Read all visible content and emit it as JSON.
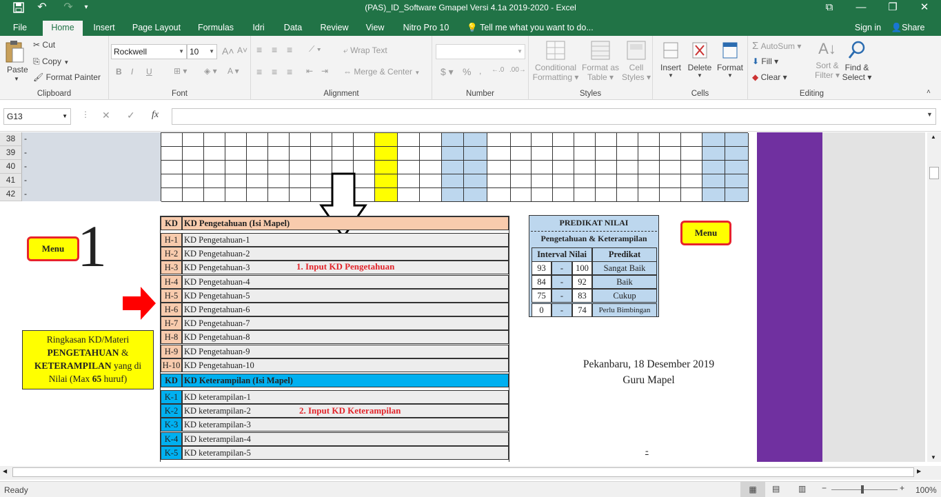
{
  "window": {
    "title": "(PAS)_ID_Software Gmapel Versi 4.1a 2019-2020  -  Excel",
    "quick_access": {
      "save": "save-icon",
      "undo": "undo-icon",
      "redo": "redo-icon",
      "customize": "▾"
    }
  },
  "tabs": [
    "File",
    "Home",
    "Insert",
    "Page Layout",
    "Formulas",
    "Idri",
    "Data",
    "Review",
    "View",
    "Nitro Pro 10"
  ],
  "tell_me": "Tell me what you want to do...",
  "account": {
    "signin": "Sign in",
    "share": "Share"
  },
  "ribbon": {
    "clipboard": {
      "paste": "Paste",
      "cut": "Cut",
      "copy": "Copy",
      "format_painter": "Format Painter",
      "label": "Clipboard"
    },
    "font": {
      "name": "Rockwell",
      "size": "10",
      "label": "Font",
      "bold": "B",
      "italic": "I",
      "underline": "U"
    },
    "alignment": {
      "wrap": "Wrap Text",
      "merge": "Merge & Center",
      "label": "Alignment"
    },
    "number": {
      "format": "",
      "label": "Number",
      "currency": "$",
      "percent": "%"
    },
    "styles": {
      "conditional": "Conditional",
      "conditional2": "Formatting",
      "format_table": "Format as",
      "format_table2": "Table",
      "cell_styles": "Cell",
      "cell_styles2": "Styles",
      "label": "Styles"
    },
    "cells": {
      "insert": "Insert",
      "delete": "Delete",
      "format": "Format",
      "label": "Cells"
    },
    "editing": {
      "autosum": "AutoSum",
      "fill": "Fill",
      "clear": "Clear",
      "sort": "Sort &",
      "sort2": "Filter",
      "find": "Find &",
      "find2": "Select",
      "label": "Editing"
    }
  },
  "formula_bar": {
    "name_box": "G13",
    "fx": "fx",
    "content": ""
  },
  "rows": [
    {
      "num": "38",
      "val": "-"
    },
    {
      "num": "39",
      "val": "-"
    },
    {
      "num": "40",
      "val": "-"
    },
    {
      "num": "41",
      "val": "-"
    },
    {
      "num": "42",
      "val": "-"
    }
  ],
  "sheet": {
    "menu_left": "Menu",
    "menu_right": "Menu",
    "big_number": "1",
    "summary_note": {
      "l1": "Ringkasan KD/Materi",
      "l2": "PENGETAHUAN",
      "l2b": " &",
      "l3": "KETERAMPILAN",
      "l3b": " yang di",
      "l4a": "Nilai (Max ",
      "l4b": "65",
      "l4c": " huruf)"
    },
    "kd_header_p": {
      "code": "KD",
      "title": "KD Pengetahuan (Isi Mapel)"
    },
    "kd_p": [
      {
        "code": "H-1",
        "name": "KD Pengetahuan-1"
      },
      {
        "code": "H-2",
        "name": "KD Pengetahuan-2"
      },
      {
        "code": "H-3",
        "name": "KD Pengetahuan-3"
      },
      {
        "code": "H-4",
        "name": "KD Pengetahuan-4"
      },
      {
        "code": "H-5",
        "name": "KD Pengetahuan-5"
      },
      {
        "code": "H-6",
        "name": "KD Pengetahuan-6"
      },
      {
        "code": "H-7",
        "name": "KD Pengetahuan-7"
      },
      {
        "code": "H-8",
        "name": "KD Pengetahuan-8"
      },
      {
        "code": "H-9",
        "name": "KD Pengetahuan-9"
      },
      {
        "code": "H-10",
        "name": "KD Pengetahuan-10"
      }
    ],
    "kd_header_k": {
      "code": "KD",
      "title": "KD Keterampilan (Isi Mapel)"
    },
    "kd_k": [
      {
        "code": "K-1",
        "name": "KD keterampilan-1"
      },
      {
        "code": "K-2",
        "name": "KD keterampilan-2"
      },
      {
        "code": "K-3",
        "name": "KD keterampilan-3"
      },
      {
        "code": "K-4",
        "name": "KD keterampilan-4"
      },
      {
        "code": "K-5",
        "name": "KD keterampilan-5"
      }
    ],
    "note_p": "1. Input KD Pengetahuan",
    "note_k": "2. Input KD Keterampilan",
    "predikat": {
      "title": "PREDIKAT NILAI",
      "subtitle": "Pengetahuan & Keterampilan",
      "col1": "Interval Nilai",
      "col2": "Predikat",
      "rows": [
        {
          "lo": "93",
          "dash": "-",
          "hi": "100",
          "label": "Sangat Baik"
        },
        {
          "lo": "84",
          "dash": "-",
          "hi": "92",
          "label": "Baik"
        },
        {
          "lo": "75",
          "dash": "-",
          "hi": "83",
          "label": "Cukup"
        },
        {
          "lo": "0",
          "dash": "-",
          "hi": "74",
          "label": "Perlu Bimbingan"
        }
      ]
    },
    "signature": {
      "place_date": "Pekanbaru, 18 Desember 2019",
      "role": "Guru Mapel",
      "name": "-"
    }
  },
  "status": {
    "ready": "Ready",
    "zoom": "100%"
  },
  "colors": {
    "excel_green": "#217346",
    "peach": "#f8cbad",
    "cyan": "#00b0f0",
    "yellow": "#ffff00",
    "purple": "#7030a0",
    "lightblue": "#bdd7ee"
  }
}
